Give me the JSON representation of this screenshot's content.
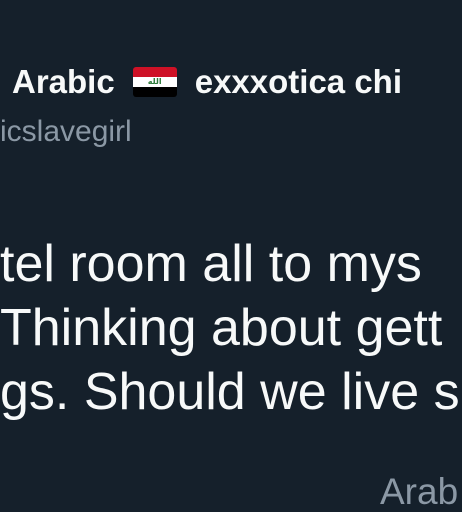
{
  "tweet": {
    "display_name_part1": "Arabic",
    "flag_icon": "iraq-flag-icon",
    "flag_colors": [
      "#ce1126",
      "#ffffff",
      "#000000"
    ],
    "display_name_part2": "exxxotica chi",
    "handle": "icslavegirl",
    "body_lines": [
      "tel room all to mys",
      "Thinking about gett",
      "gs. Should we live s"
    ],
    "footer_text": "Arab"
  }
}
